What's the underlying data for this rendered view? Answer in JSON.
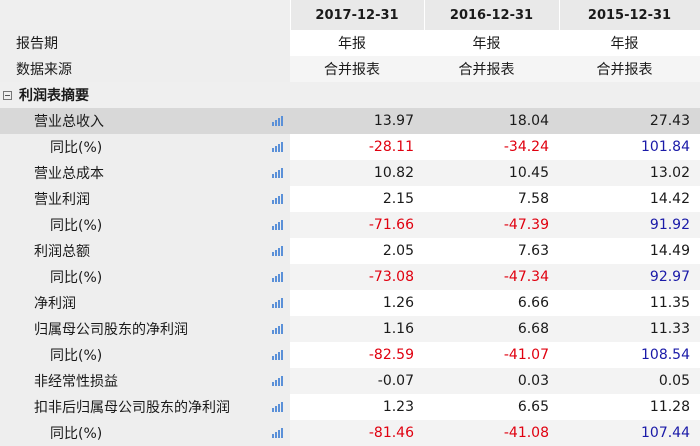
{
  "header": {
    "periods": [
      "2017-12-31",
      "2016-12-31",
      "2015-12-31"
    ]
  },
  "meta_rows": [
    {
      "label": "报告期",
      "values": [
        "年报",
        "年报",
        "年报"
      ]
    },
    {
      "label": "数据来源",
      "values": [
        "合并报表",
        "合并报表",
        "合并报表"
      ]
    }
  ],
  "section": {
    "label": "利润表摘要"
  },
  "rows": [
    {
      "label": "营业总收入",
      "level": 1,
      "values": [
        "13.97",
        "18.04",
        "27.43"
      ]
    },
    {
      "label": "同比(%)",
      "level": 2,
      "values": [
        "-28.11",
        "-34.24",
        "101.84"
      ]
    },
    {
      "label": "营业总成本",
      "level": 1,
      "values": [
        "10.82",
        "10.45",
        "13.02"
      ]
    },
    {
      "label": "营业利润",
      "level": 1,
      "values": [
        "2.15",
        "7.58",
        "14.42"
      ]
    },
    {
      "label": "同比(%)",
      "level": 2,
      "values": [
        "-71.66",
        "-47.39",
        "91.92"
      ]
    },
    {
      "label": "利润总额",
      "level": 1,
      "values": [
        "2.05",
        "7.63",
        "14.49"
      ]
    },
    {
      "label": "同比(%)",
      "level": 2,
      "values": [
        "-73.08",
        "-47.34",
        "92.97"
      ]
    },
    {
      "label": "净利润",
      "level": 1,
      "values": [
        "1.26",
        "6.66",
        "11.35"
      ]
    },
    {
      "label": "归属母公司股东的净利润",
      "level": 1,
      "values": [
        "1.16",
        "6.68",
        "11.33"
      ]
    },
    {
      "label": "同比(%)",
      "level": 2,
      "values": [
        "-82.59",
        "-41.07",
        "108.54"
      ]
    },
    {
      "label": "非经常性损益",
      "level": 1,
      "values": [
        "-0.07",
        "0.03",
        "0.05"
      ]
    },
    {
      "label": "扣非后归属母公司股东的净利润",
      "level": 1,
      "values": [
        "1.23",
        "6.65",
        "11.28"
      ]
    },
    {
      "label": "同比(%)",
      "level": 2,
      "values": [
        "-81.46",
        "-41.08",
        "107.44"
      ]
    }
  ],
  "colors": {
    "negative": "#e0000f",
    "yoy_positive": "#1a1aa8",
    "chart_icon": "#5a90d8",
    "selected_row": "#d8d8d8"
  },
  "icons": {
    "row_chart": "bar-chart-icon",
    "section_toggle": "collapse-minus-icon"
  }
}
